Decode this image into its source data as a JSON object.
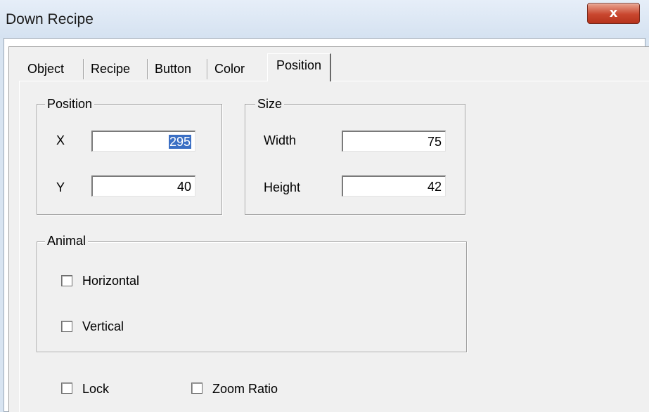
{
  "window": {
    "title": "Down Recipe",
    "close_glyph": "x"
  },
  "tabs": [
    {
      "label": "Object",
      "active": false
    },
    {
      "label": "Recipe",
      "active": false
    },
    {
      "label": "Button",
      "active": false
    },
    {
      "label": "Color",
      "active": false
    },
    {
      "label": "Position",
      "active": true
    }
  ],
  "position_group": {
    "title": "Position",
    "x_label": "X",
    "x_value": "295",
    "y_label": "Y",
    "y_value": "40"
  },
  "size_group": {
    "title": "Size",
    "width_label": "Width",
    "width_value": "75",
    "height_label": "Height",
    "height_value": "42"
  },
  "animal_group": {
    "title": "Animal",
    "horizontal_label": "Horizontal",
    "horizontal_checked": false,
    "vertical_label": "Vertical",
    "vertical_checked": false
  },
  "options": {
    "lock_label": "Lock",
    "lock_checked": false,
    "zoom_ratio_label": "Zoom Ratio",
    "zoom_ratio_checked": false
  },
  "colors": {
    "selection": "#3b6fc4",
    "close_button": "#c9472f",
    "dialog_face": "#f0f0f0"
  }
}
